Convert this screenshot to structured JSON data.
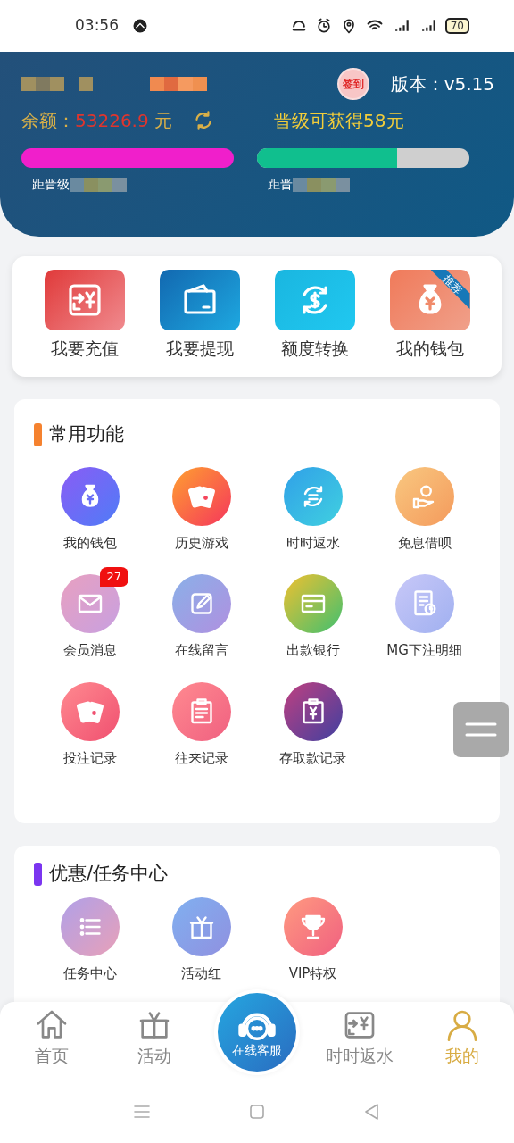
{
  "status_bar": {
    "time": "03:56",
    "battery": "70"
  },
  "header": {
    "sign_in": "签到",
    "version": "版本：v5.15",
    "balance_label": "余额：",
    "balance": "53226.9",
    "currency": "元",
    "promo": "晋级可获得58元",
    "progress": [
      {
        "level": 1,
        "caption": "距晋级",
        "color": "#f01fcb"
      },
      {
        "level": 0.66,
        "caption": "距晋",
        "color": "#10bf8e"
      }
    ]
  },
  "quick_actions": [
    {
      "label": "我要充值",
      "kind": "recharge"
    },
    {
      "label": "我要提现",
      "kind": "withdraw"
    },
    {
      "label": "额度转换",
      "kind": "transfer"
    },
    {
      "label": "我的钱包",
      "kind": "wallet",
      "ribbon": "推荐"
    }
  ],
  "sections": [
    {
      "title": "常用功能",
      "color": "#f5822f",
      "items": [
        {
          "label": "我的钱包",
          "kind": "moneybag"
        },
        {
          "label": "历史游戏",
          "kind": "cards"
        },
        {
          "label": "时时返水",
          "kind": "rebate"
        },
        {
          "label": "免息借呗",
          "kind": "loan"
        },
        {
          "label": "会员消息",
          "kind": "message",
          "badge": "27"
        },
        {
          "label": "在线留言",
          "kind": "guestbook"
        },
        {
          "label": "出款银行",
          "kind": "bank"
        },
        {
          "label": "MG下注明细",
          "kind": "mg"
        },
        {
          "label": "投注记录",
          "kind": "bets"
        },
        {
          "label": "往来记录",
          "kind": "records"
        },
        {
          "label": "存取款记录",
          "kind": "deposit"
        }
      ]
    },
    {
      "title": "优惠/任务中心",
      "color": "#7b35f0",
      "items": [
        {
          "label": "任务中心",
          "kind": "tasks"
        },
        {
          "label": "活动红",
          "kind": "gift"
        },
        {
          "label": "VIP特权",
          "kind": "vip"
        }
      ]
    }
  ],
  "bottom_nav": [
    {
      "label": "首页",
      "kind": "home",
      "selected": false
    },
    {
      "label": "活动",
      "kind": "gift",
      "selected": false
    },
    {
      "label": "在线客服",
      "kind": "service",
      "selected": false
    },
    {
      "label": "时时返水",
      "kind": "rebate",
      "selected": false
    },
    {
      "label": "我的",
      "kind": "user",
      "selected": true
    }
  ]
}
